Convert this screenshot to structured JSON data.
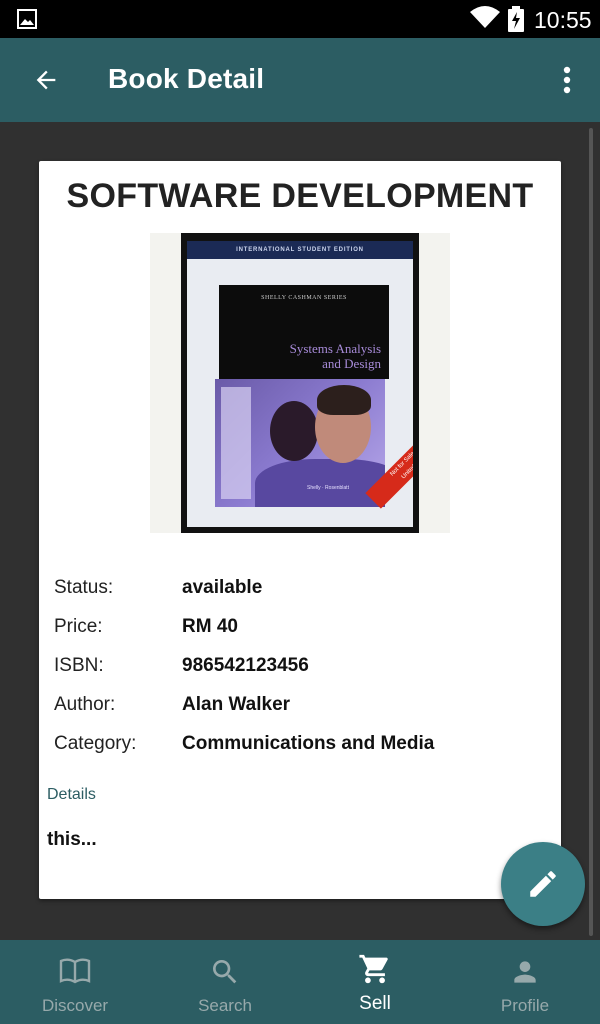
{
  "status_bar": {
    "time": "10:55",
    "icons": [
      "gallery-icon",
      "wifi-icon",
      "battery-icon"
    ]
  },
  "app_bar": {
    "title": "Book Detail",
    "back_icon": "arrow-left-icon",
    "menu_icon": "more-vert-icon"
  },
  "book": {
    "title": "SOFTWARE DEVELOPMENT",
    "cover": {
      "banner": "INTERNATIONAL STUDENT EDITION",
      "series": "SHELLY CASHMAN SERIES",
      "name_line1": "Systems Analysis",
      "name_line2": "and Design",
      "authors": "Shelly · Rosenblatt",
      "band_line1": "Not for Sale in the",
      "band_line2": "United States"
    },
    "fields": [
      {
        "label": "Status:",
        "value": "available"
      },
      {
        "label": "Price:",
        "value": "RM 40"
      },
      {
        "label": "ISBN:",
        "value": "986542123456"
      },
      {
        "label": "Author:",
        "value": "Alan Walker"
      },
      {
        "label": "Category:",
        "value": "Communications and Media"
      }
    ],
    "details_heading": "Details",
    "details_text": "this..."
  },
  "fab": {
    "icon": "edit-pencil-icon"
  },
  "bottom_nav": {
    "items": [
      {
        "label": "Discover",
        "icon": "book-open-icon",
        "active": false
      },
      {
        "label": "Search",
        "icon": "search-icon",
        "active": false
      },
      {
        "label": "Sell",
        "icon": "cart-icon",
        "active": true
      },
      {
        "label": "Profile",
        "icon": "person-icon",
        "active": false
      }
    ]
  },
  "colors": {
    "primary": "#2c5d63",
    "fab": "#3b7f86",
    "background": "#303030",
    "nav_inactive": "#97a9ab"
  }
}
